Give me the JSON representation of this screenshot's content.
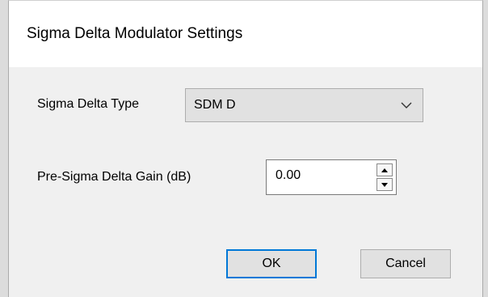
{
  "dialog": {
    "title": "Sigma Delta Modulator Settings"
  },
  "sigma_delta_type": {
    "label": "Sigma Delta Type",
    "selected": "SDM D",
    "icon": "chevron-down-icon"
  },
  "gain": {
    "label": "Pre-Sigma Delta Gain (dB)",
    "value": "0.00",
    "up_icon": "triangle-up-icon",
    "down_icon": "triangle-down-icon"
  },
  "buttons": {
    "ok_label": "OK",
    "cancel_label": "Cancel"
  },
  "colors": {
    "accent": "#0078d7",
    "dialog_bg": "#f0f0f0",
    "title_bg": "#ffffff"
  }
}
